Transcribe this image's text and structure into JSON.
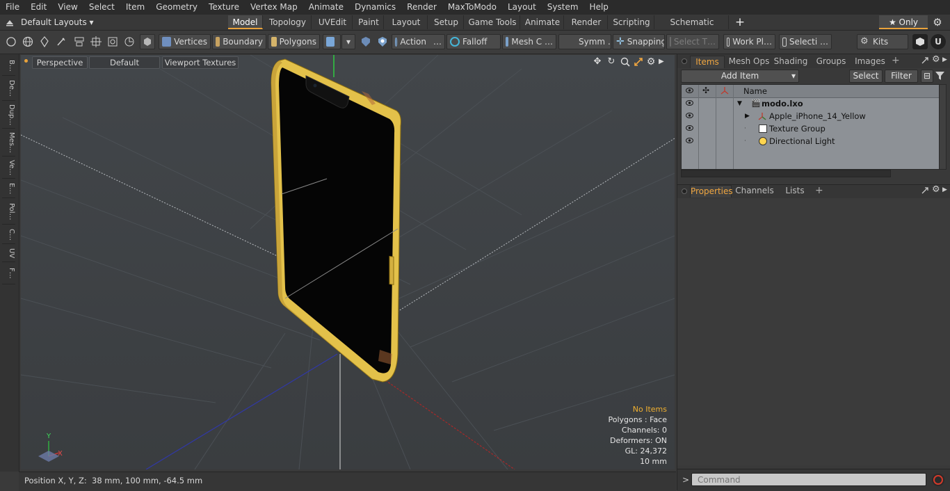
{
  "menubar": {
    "items": [
      "File",
      "Edit",
      "View",
      "Select",
      "Item",
      "Geometry",
      "Texture",
      "Vertex Map",
      "Animate",
      "Dynamics",
      "Render",
      "MaxToModo",
      "Layout",
      "System",
      "Help"
    ]
  },
  "layoutbar": {
    "layout_dropdown": "Default Layouts ▾",
    "tabs": [
      "Model",
      "Topology",
      "UVEdit",
      "Paint",
      "Layout",
      "Setup",
      "Game Tools",
      "Animate",
      "Render",
      "Scripting",
      "Schematic Fusion"
    ],
    "active_tab": "Model",
    "only_label": "★ Only"
  },
  "toolbar": {
    "vertices": "Vertices",
    "boundary": "Boundary",
    "polygons": "Polygons",
    "action": "Action",
    "action_more": "…",
    "falloff": "Falloff",
    "mesh": "Mesh C …",
    "symm": "Symm …",
    "snapping": "Snapping",
    "select_t": "Select T…",
    "work_pl": "Work Pl…",
    "selecti": "Selecti …",
    "kits": "Kits"
  },
  "left_tabs": [
    "B…",
    "De…",
    "Dup…",
    "Mes…",
    "Ve…",
    "E…",
    "Pol…",
    "C…",
    "UV",
    "F…"
  ],
  "viewport": {
    "view_mode": "Perspective",
    "shading": "Default",
    "textures": "Viewport Textures",
    "info": {
      "no_items": "No Items",
      "polygons": "Polygons : Face",
      "channels": "Channels: 0",
      "deformers": "Deformers: ON",
      "gl": "GL: 24,372",
      "scale": "10 mm"
    },
    "axis_x": "X",
    "axis_y": "Y",
    "phone_color": "#e3c14a"
  },
  "statusbar": {
    "position": "Position X, Y, Z:  38 mm, 100 mm, -64.5 mm"
  },
  "right_panel": {
    "tabs": [
      "Items",
      "Mesh Ops",
      "Shading",
      "Groups",
      "Images"
    ],
    "active_tab": "Items",
    "add_item": "Add Item",
    "select": "Select",
    "filter": "Filter",
    "name_header": "Name",
    "items": [
      {
        "label": "modo.lxo",
        "bold": true
      },
      {
        "label": "Apple_iPhone_14_Yellow"
      },
      {
        "label": "Texture Group"
      },
      {
        "label": "Directional Light"
      }
    ],
    "lower_tabs": [
      "Properties",
      "Channels",
      "Lists"
    ],
    "lower_active": "Properties",
    "command_placeholder": "Command",
    "prompt": ">"
  },
  "colors": {
    "accent": "#e9a33b",
    "viewport_bg": "#3f4347",
    "list_bg": "#8d9196"
  }
}
